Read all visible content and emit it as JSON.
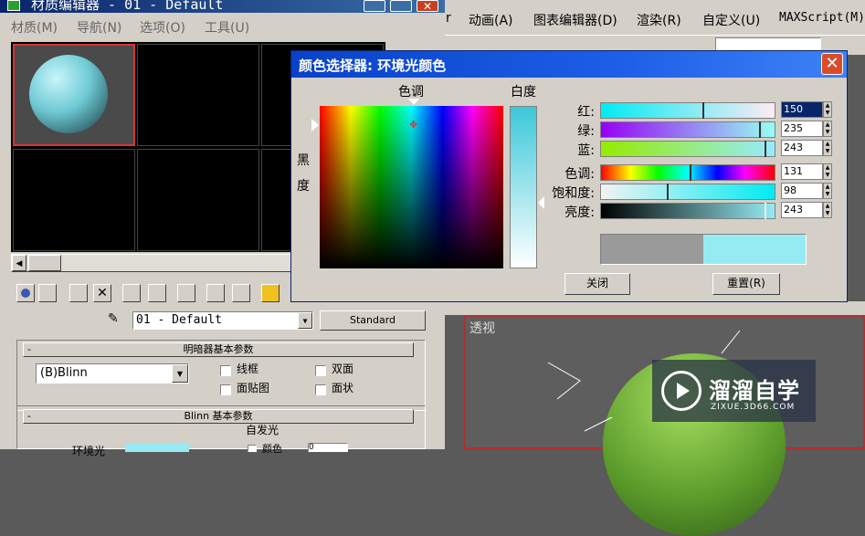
{
  "material_editor": {
    "title": "材质编辑器 - 01 - Default",
    "menu": [
      "材质(M)",
      "导航(N)",
      "选项(O)",
      "工具(U)"
    ],
    "material_name": "01 - Default",
    "material_type": "Standard",
    "shader_rollout": "明暗器基本参数",
    "shader": "(B)Blinn",
    "checkboxes": [
      "线框",
      "双面",
      "面贴图",
      "面状"
    ],
    "blinn_rollout": "Blinn 基本参数",
    "self_illum": "自发光",
    "ambient": "环境光",
    "color_label": "颜色",
    "color_value": "0"
  },
  "max_menu": {
    "items": [
      "r",
      "动画(A)",
      "图表编辑器(D)",
      "渲染(R)",
      "自定义(U)",
      "MAXScript(M)"
    ]
  },
  "viewport": {
    "label": "透视"
  },
  "color_picker": {
    "title": "颜色选择器: 环境光颜色",
    "hue_label": "色调",
    "whiteness_label": "白度",
    "blackness_label": "黑度",
    "close_button": "关闭",
    "reset_button": "重置(R)",
    "sliders": [
      {
        "label": "红:",
        "value": "150",
        "level": 0.59
      },
      {
        "label": "绿:",
        "value": "235",
        "level": 0.92
      },
      {
        "label": "蓝:",
        "value": "243",
        "level": 0.95
      },
      {
        "label": "色调:",
        "value": "131",
        "level": 0.51
      },
      {
        "label": "饱和度:",
        "value": "98",
        "level": 0.38
      },
      {
        "label": "亮度:",
        "value": "243",
        "level": 0.95
      }
    ],
    "old_color": "#9a9a9a",
    "new_color": "#96ebf3"
  },
  "watermark": {
    "brand": "溜溜自学",
    "url": "ZIXUE.3D66.COM"
  }
}
